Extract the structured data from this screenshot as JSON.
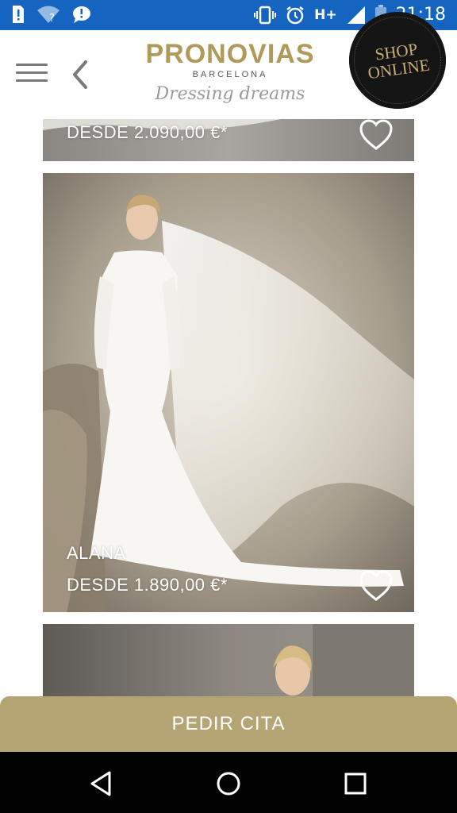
{
  "status_bar": {
    "time": "21:18",
    "network": "H+",
    "icons": [
      "sim-alert-icon",
      "wifi-question-icon",
      "chat-icon",
      "vibrate-icon",
      "alarm-icon",
      "signal-icon",
      "battery-icon"
    ],
    "background": "#1565c0"
  },
  "header": {
    "brand": "PRONOVIAS",
    "brand_sub": "BARCELONA",
    "tagline": "Dressing dreams",
    "shop_badge": {
      "line1": "SHOP",
      "line2": "ONLINE"
    },
    "icons": [
      "hamburger-menu-icon",
      "back-chevron-icon"
    ],
    "brand_color": "#b09a5a"
  },
  "products": [
    {
      "name": "",
      "price": "DESDE 2.090,00 €*",
      "favorite_icon": "heart-outline-icon"
    },
    {
      "name": "ALANA",
      "price": "DESDE 1.890,00 €*",
      "favorite_icon": "heart-outline-icon"
    },
    {
      "name": "",
      "price": "",
      "favorite_icon": ""
    }
  ],
  "cta": {
    "label": "PEDIR CITA",
    "color": "#b5a575"
  },
  "nav_bar": {
    "icons": [
      "back-triangle-icon",
      "home-circle-icon",
      "recents-square-icon"
    ]
  }
}
